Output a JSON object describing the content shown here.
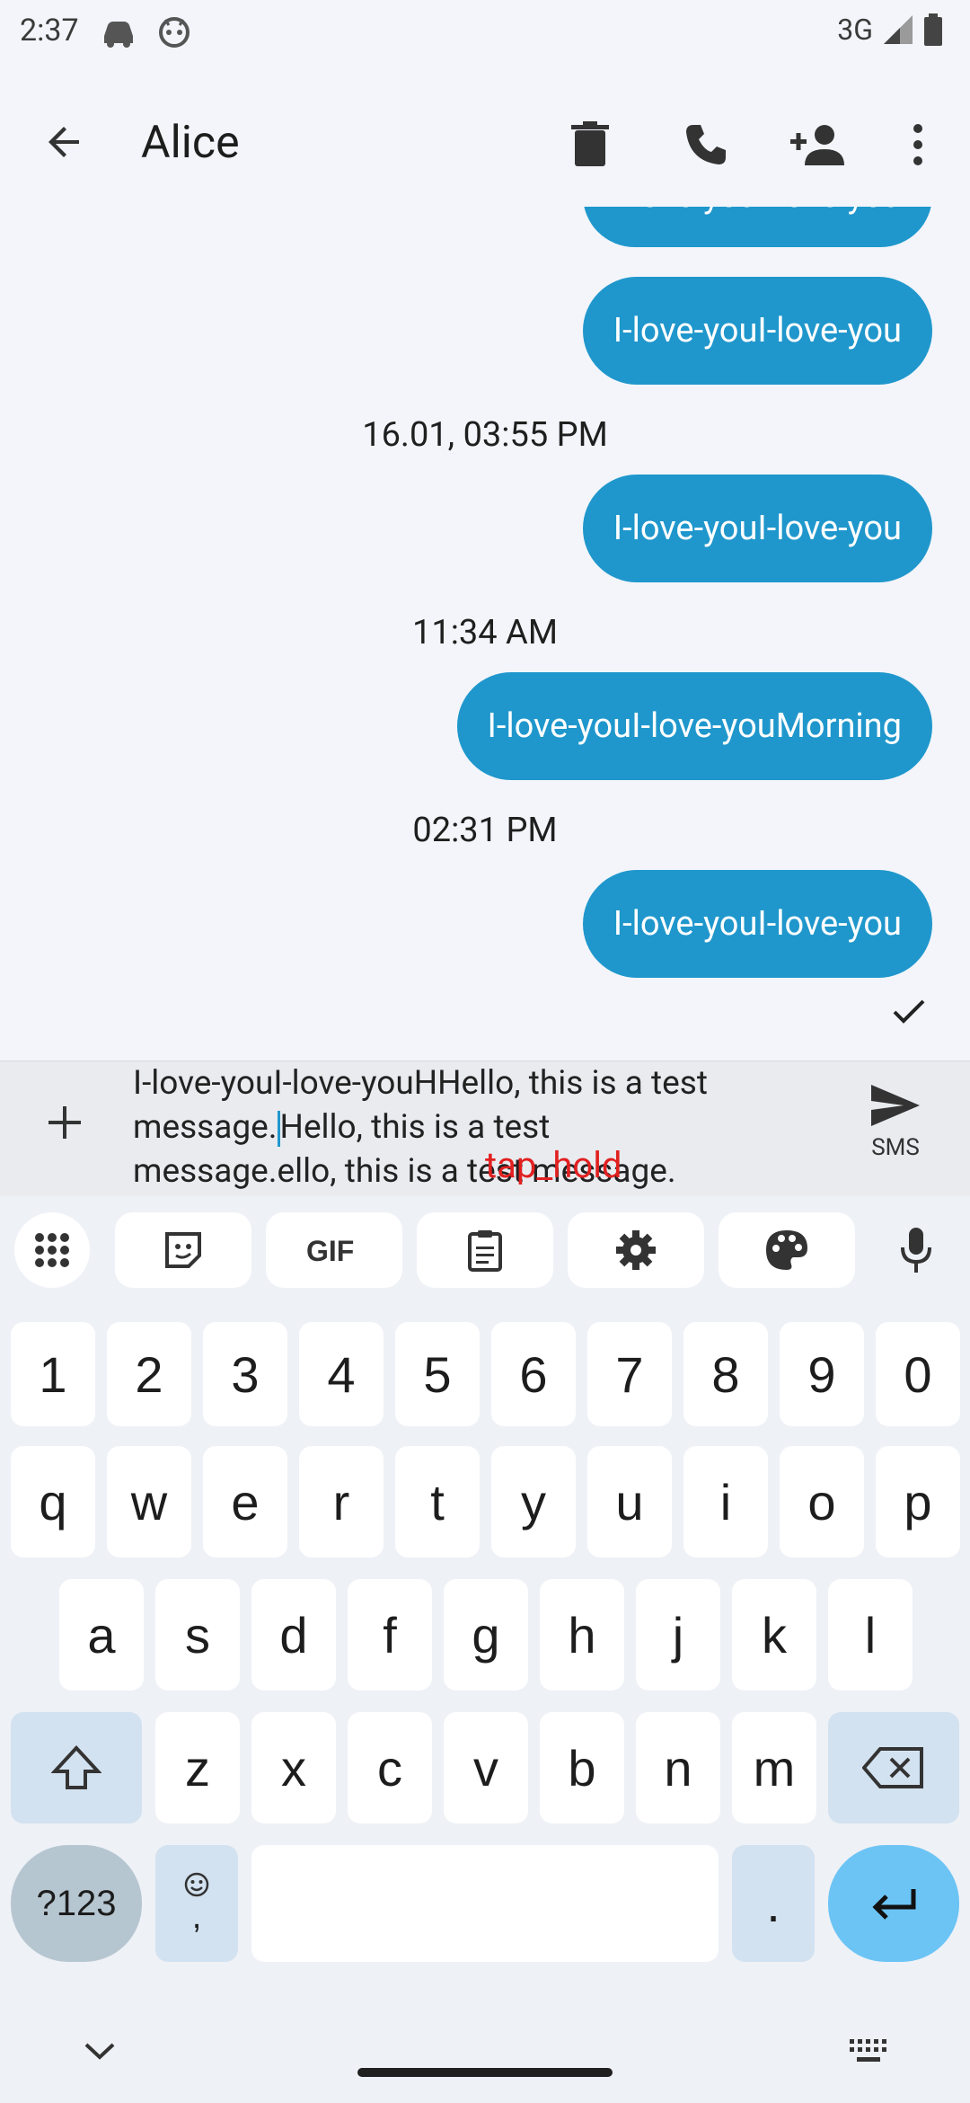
{
  "status": {
    "time": "2:37",
    "network": "3G"
  },
  "appbar": {
    "title": "Alice"
  },
  "messages": {
    "bubble_partial": "I-love-youI-love-you",
    "bubble1": "I-love-youI-love-you",
    "stamp1": "16.01, 03:55 PM",
    "bubble2": "I-love-youI-love-you",
    "stamp2": "11:34 AM",
    "bubble3": "I-love-youI-love-youMorning",
    "stamp3": "02:31 PM",
    "bubble4": "I-love-youI-love-you"
  },
  "composer": {
    "line1": "I-love-youI-love-youHHello, this is a test",
    "line2_before_cursor": "message.",
    "line2_after_cursor": "Hello, this is a test",
    "line3": "message.ello, this is a test message.",
    "overlay": "tap_hold",
    "send_label": "SMS"
  },
  "keyboard": {
    "row_numbers": [
      "1",
      "2",
      "3",
      "4",
      "5",
      "6",
      "7",
      "8",
      "9",
      "0"
    ],
    "row_q": [
      "q",
      "w",
      "e",
      "r",
      "t",
      "y",
      "u",
      "i",
      "o",
      "p"
    ],
    "row_a": [
      "a",
      "s",
      "d",
      "f",
      "g",
      "h",
      "j",
      "k",
      "l"
    ],
    "row_z": [
      "z",
      "x",
      "c",
      "v",
      "b",
      "n",
      "m"
    ],
    "sym_key": "?123",
    "comma_key": ",",
    "period_key": "."
  },
  "colors": {
    "bubble": "#1f97cc",
    "background": "#f3f5fa"
  }
}
